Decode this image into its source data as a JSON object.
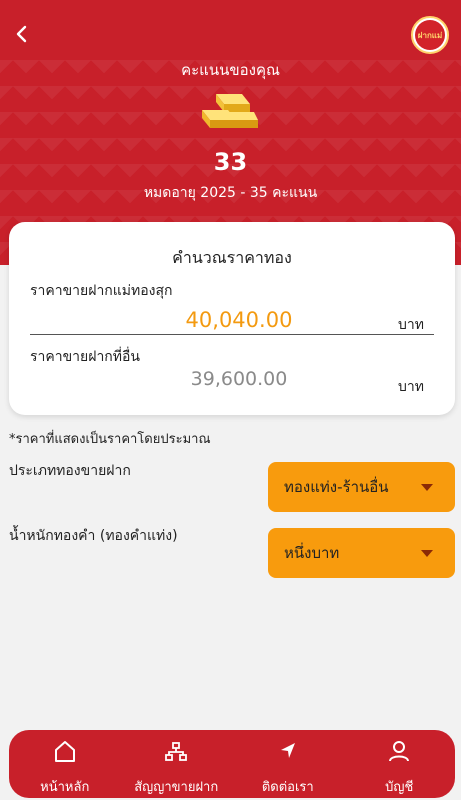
{
  "header": {
    "score_title": "คะแนนของคุณ",
    "score_value": "33",
    "expire_text": "หมดอายุ 2025 - 35 คะแนน",
    "logo_text": "ฝากแม่"
  },
  "calculator": {
    "title": "คำนวณราคาทอง",
    "row1_label": "ราคาขายฝากแม่ทองสุก",
    "row1_price": "40,040.00",
    "row1_unit": "บาท",
    "row2_label": "ราคาขายฝากที่อื่น",
    "row2_price": "39,600.00",
    "row2_unit": "บาท"
  },
  "note": "*ราคาที่แสดงเป็นราคาโดยประมาณ",
  "fields": {
    "type_label": "ประเภททองขายฝาก",
    "type_value": "ทองแท่ง-ร้านอื่น",
    "weight_label": "น้ำหนักทองคำ (ทองคำแท่ง)",
    "weight_value": "หนึ่งบาท"
  },
  "nav": {
    "home": "หน้าหลัก",
    "contract": "สัญญาขายฝาก",
    "contact": "ติดต่อเรา",
    "account": "บัญชี"
  },
  "colors": {
    "brand_red": "#c8202a",
    "accent_orange": "#f89b0d",
    "price_orange": "#f39a10"
  }
}
